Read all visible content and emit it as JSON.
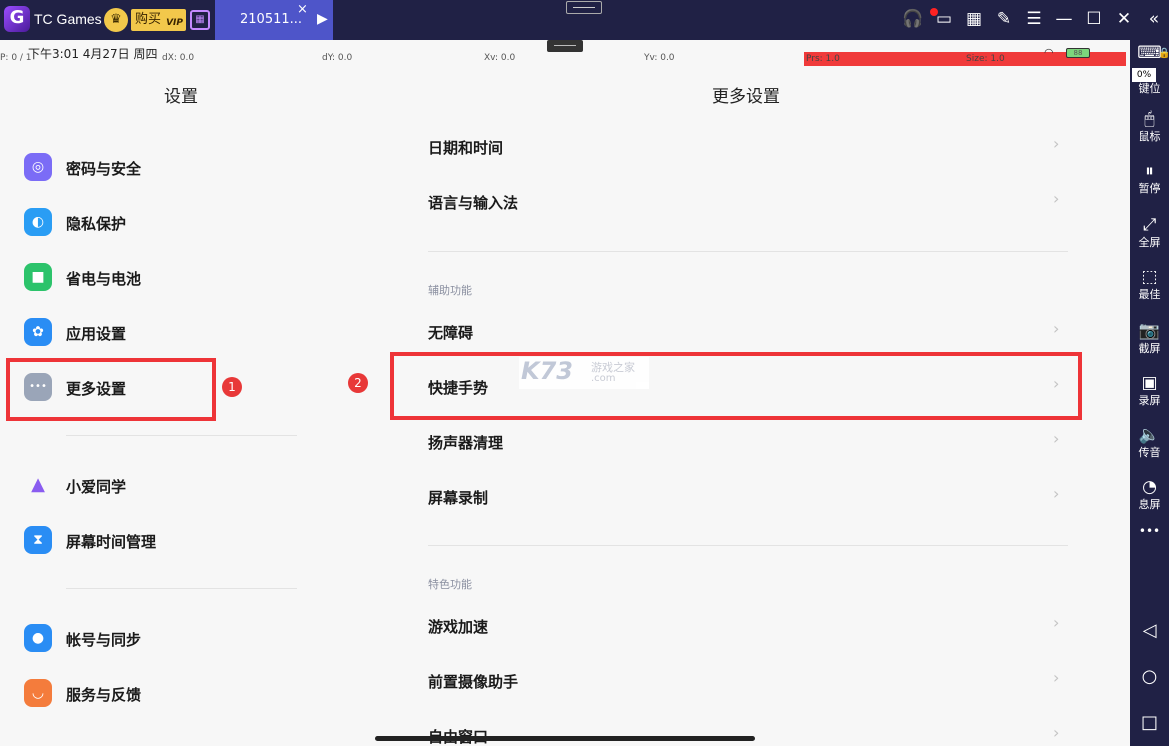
{
  "titlebar": {
    "app_name": "TC Games",
    "logo_text": "G",
    "buy_label": "购买",
    "buy_vip": "VIP",
    "tab_label": "210511...",
    "tab_close": "×",
    "tab_arrow": "▶",
    "icons": {
      "headset": "headset-icon",
      "chat": "chat-icon",
      "grid": "grid-icon",
      "pin": "pin-icon",
      "menu": "menu-icon",
      "minimize": "minimize-icon",
      "maximize": "maximize-icon",
      "close": "close-icon",
      "collapse": "collapse-icon"
    },
    "glyphs": {
      "crown": "♛",
      "cal": "▦",
      "headset": "🎧",
      "chat": "▭",
      "grid": "▦",
      "pin": "✎",
      "menu": "☰",
      "minimize": "—",
      "maximize": "☐",
      "close": "✕",
      "collapse": "«"
    }
  },
  "statusbar": {
    "p": "P: 0 / 1",
    "time": "下午3:01 4月27日 周四",
    "dx": "dX: 0.0",
    "dy": "dY: 0.0",
    "xv": "Xv: 0.0",
    "yv": "Yv: 0.0",
    "prs": "Prs: 1.0",
    "size": "Size: 1.0",
    "battery": "88"
  },
  "left": {
    "title": "设置",
    "items": [
      {
        "label": "密码与安全",
        "glyph": "◎",
        "color": "#7b6cf6"
      },
      {
        "label": "隐私保护",
        "glyph": "◐",
        "color": "#2a9df4"
      },
      {
        "label": "省电与电池",
        "glyph": "■",
        "color": "#2cc36b"
      },
      {
        "label": "应用设置",
        "glyph": "✿",
        "color": "#2a8df4"
      },
      {
        "label": "更多设置",
        "glyph": "•••",
        "color": "#9aa5b8"
      },
      {
        "label": "小爱同学",
        "glyph": "▲",
        "color": "#ffffff"
      },
      {
        "label": "屏幕时间管理",
        "glyph": "⧗",
        "color": "#2a8df4"
      },
      {
        "label": "帐号与同步",
        "glyph": "●",
        "color": "#2a8df4"
      },
      {
        "label": "服务与反馈",
        "glyph": "◡",
        "color": "#f47c3c"
      }
    ]
  },
  "right": {
    "title": "更多设置",
    "items": [
      {
        "label": "日期和时间"
      },
      {
        "label": "语言与输入法"
      },
      {
        "label": "无障碍"
      },
      {
        "label": "快捷手势"
      },
      {
        "label": "扬声器清理"
      },
      {
        "label": "屏幕录制"
      },
      {
        "label": "游戏加速"
      },
      {
        "label": "前置摄像助手"
      },
      {
        "label": "自由窗口"
      }
    ],
    "sections": [
      "辅助功能",
      "特色功能"
    ],
    "chevron": "›"
  },
  "annotations": {
    "badge1": "1",
    "badge2": "2",
    "color": "#ee3438"
  },
  "watermark": {
    "logo": "K73",
    "cn": "游戏之家",
    ".com": ".com",
    "com": ".com"
  },
  "toolbar": {
    "percent": "0%",
    "buttons": [
      {
        "label": "键位",
        "icon": "keyboard-icon",
        "glyph": "⌨"
      },
      {
        "label": "鼠标",
        "icon": "mouse-icon",
        "glyph": "🖱"
      },
      {
        "label": "暂停",
        "icon": "pause-icon",
        "glyph": "⏸"
      },
      {
        "label": "全屏",
        "icon": "fullscreen-icon",
        "glyph": "⤢"
      },
      {
        "label": "最佳",
        "icon": "best-fit-icon",
        "glyph": "⬚"
      },
      {
        "label": "截屏",
        "icon": "camera-icon",
        "glyph": "📷"
      },
      {
        "label": "录屏",
        "icon": "record-icon",
        "glyph": "▣"
      },
      {
        "label": "传音",
        "icon": "audio-icon",
        "glyph": "🔈"
      },
      {
        "label": "息屏",
        "icon": "screen-off-icon",
        "glyph": "◔"
      }
    ],
    "more": "•••",
    "nav": {
      "back": "◁",
      "home": "○",
      "recent": "□"
    }
  }
}
